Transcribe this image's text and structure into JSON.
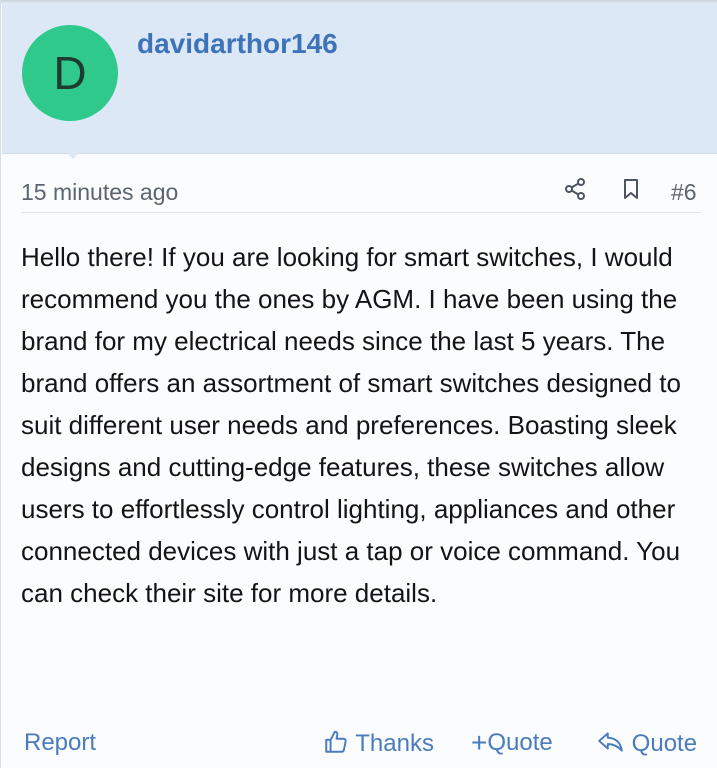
{
  "post": {
    "avatar_letter": "D",
    "username": "davidarthor146",
    "timestamp": "15 minutes ago",
    "post_number": "#6",
    "body": "Hello there! If you are looking for smart switches, I would recommend you the ones by AGM. I have been using the brand for my electrical needs since the last 5 years. The brand offers an assortment of smart switches designed to suit different user needs and preferences. Boasting sleek designs and cutting-edge features, these switches allow users to effortlessly control lighting, appliances and other connected devices with just a tap or voice command. You can check their site for more details."
  },
  "actions": {
    "report": "Report",
    "thanks": "Thanks",
    "plus_quote": "Quote",
    "quote": "Quote"
  },
  "icons": {
    "share": "share-icon",
    "bookmark": "bookmark-icon",
    "thumbs_up": "thumbs-up-icon",
    "plus": "plus-icon",
    "reply": "reply-icon"
  },
  "colors": {
    "header_bg": "#dde8f7",
    "avatar_bg": "#2fc98b",
    "username": "#3d73b8",
    "link": "#4a7bbd",
    "text": "#141414",
    "muted": "#5b6470"
  }
}
